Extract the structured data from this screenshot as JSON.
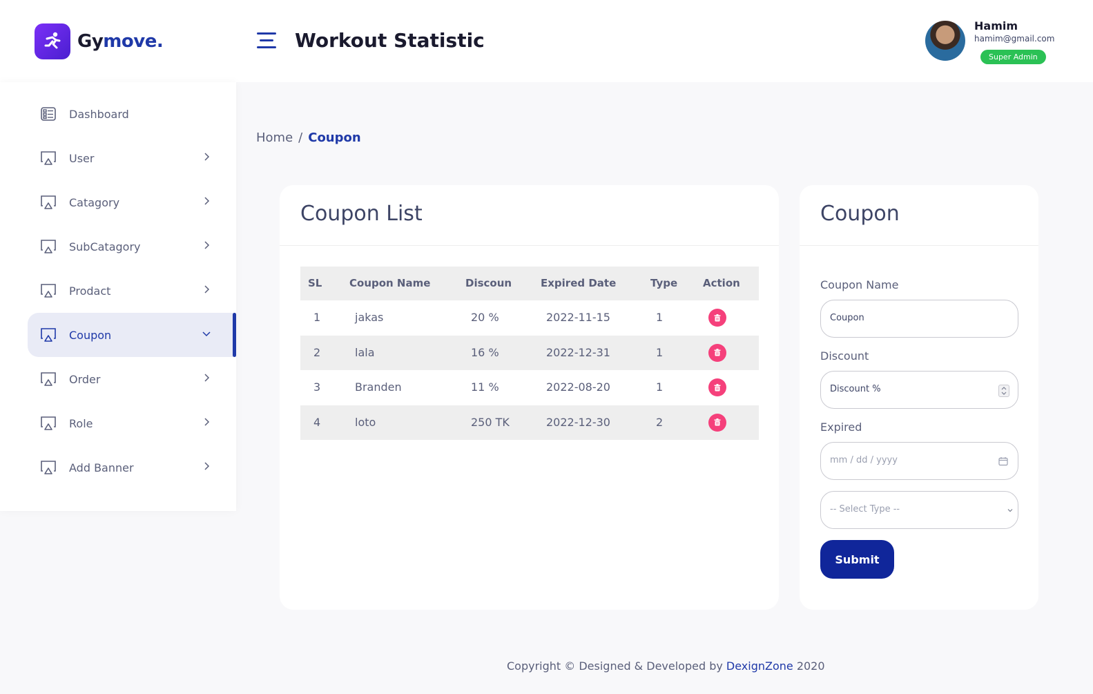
{
  "brand": {
    "name_start": "Gy",
    "name_accent": "move."
  },
  "header": {
    "title": "Workout Statistic"
  },
  "profile": {
    "name": "Hamim",
    "email": "hamim@gmail.com",
    "role": "Super Admin"
  },
  "sidebar": {
    "items": [
      {
        "label": "Dashboard",
        "icon": "dashboard-icon"
      },
      {
        "label": "User",
        "icon": "monitor-icon"
      },
      {
        "label": "Catagory",
        "icon": "monitor-icon"
      },
      {
        "label": "SubCatagory",
        "icon": "monitor-icon"
      },
      {
        "label": "Prodact",
        "icon": "monitor-icon"
      },
      {
        "label": "Coupon",
        "icon": "monitor-icon",
        "active": true
      },
      {
        "label": "Order",
        "icon": "monitor-icon"
      },
      {
        "label": "Role",
        "icon": "monitor-icon"
      },
      {
        "label": "Add Banner",
        "icon": "monitor-icon"
      }
    ]
  },
  "breadcrumb": {
    "home": "Home",
    "separator": "/",
    "current": "Coupon"
  },
  "coupon_list": {
    "title": "Coupon List",
    "columns": [
      "SL",
      "Coupon Name",
      "Discoun",
      "Expired Date",
      "Type",
      "Action"
    ],
    "rows": [
      {
        "sl": "1",
        "name": "jakas",
        "discount": "20 %",
        "expired": "2022-11-15",
        "type": "1"
      },
      {
        "sl": "2",
        "name": "lala",
        "discount": "16 %",
        "expired": "2022-12-31",
        "type": "1"
      },
      {
        "sl": "3",
        "name": "Branden",
        "discount": "11 %",
        "expired": "2022-08-20",
        "type": "1"
      },
      {
        "sl": "4",
        "name": "loto",
        "discount": "250 TK",
        "expired": "2022-12-30",
        "type": "2"
      }
    ]
  },
  "coupon_form": {
    "title": "Coupon",
    "name_label": "Coupon Name",
    "name_value": "Coupon",
    "discount_label": "Discount",
    "discount_placeholder": "Discount %",
    "expired_label": "Expired",
    "expired_placeholder": "mm / dd / yyyy",
    "type_placeholder": "-- Select Type --",
    "submit_label": "Submit"
  },
  "footer": {
    "text": "Copyright © Designed & Developed by ",
    "link": "DexignZone",
    "year": " 2020"
  },
  "colors": {
    "primary": "#1f39a8",
    "danger": "#f5407b",
    "success": "#2bc155",
    "button": "#10269a"
  }
}
